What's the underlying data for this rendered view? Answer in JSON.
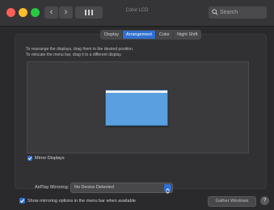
{
  "window": {
    "title": "Color LCD",
    "search_placeholder": "Search"
  },
  "tabs": [
    {
      "label": "Display",
      "active": false
    },
    {
      "label": "Arrangement",
      "active": true
    },
    {
      "label": "Color",
      "active": false
    },
    {
      "label": "Night Shift",
      "active": false
    }
  ],
  "instructions": {
    "line1": "To rearrange the displays, drag them to the desired position.",
    "line2": "To relocate the menu bar, drag it to a different display."
  },
  "mirror_displays": {
    "label": "Mirror Displays",
    "checked": true
  },
  "airplay": {
    "label": "AirPlay Mirroring:",
    "value": "No Device Detected"
  },
  "show_mirroring": {
    "label": "Show mirroring options in the menu bar when available",
    "checked": true
  },
  "gather_button": "Gather Windows",
  "help_button": "?",
  "colors": {
    "accent": "#2f6fd1",
    "display_blue": "#5aa0e0",
    "background": "#2a2a2c"
  }
}
